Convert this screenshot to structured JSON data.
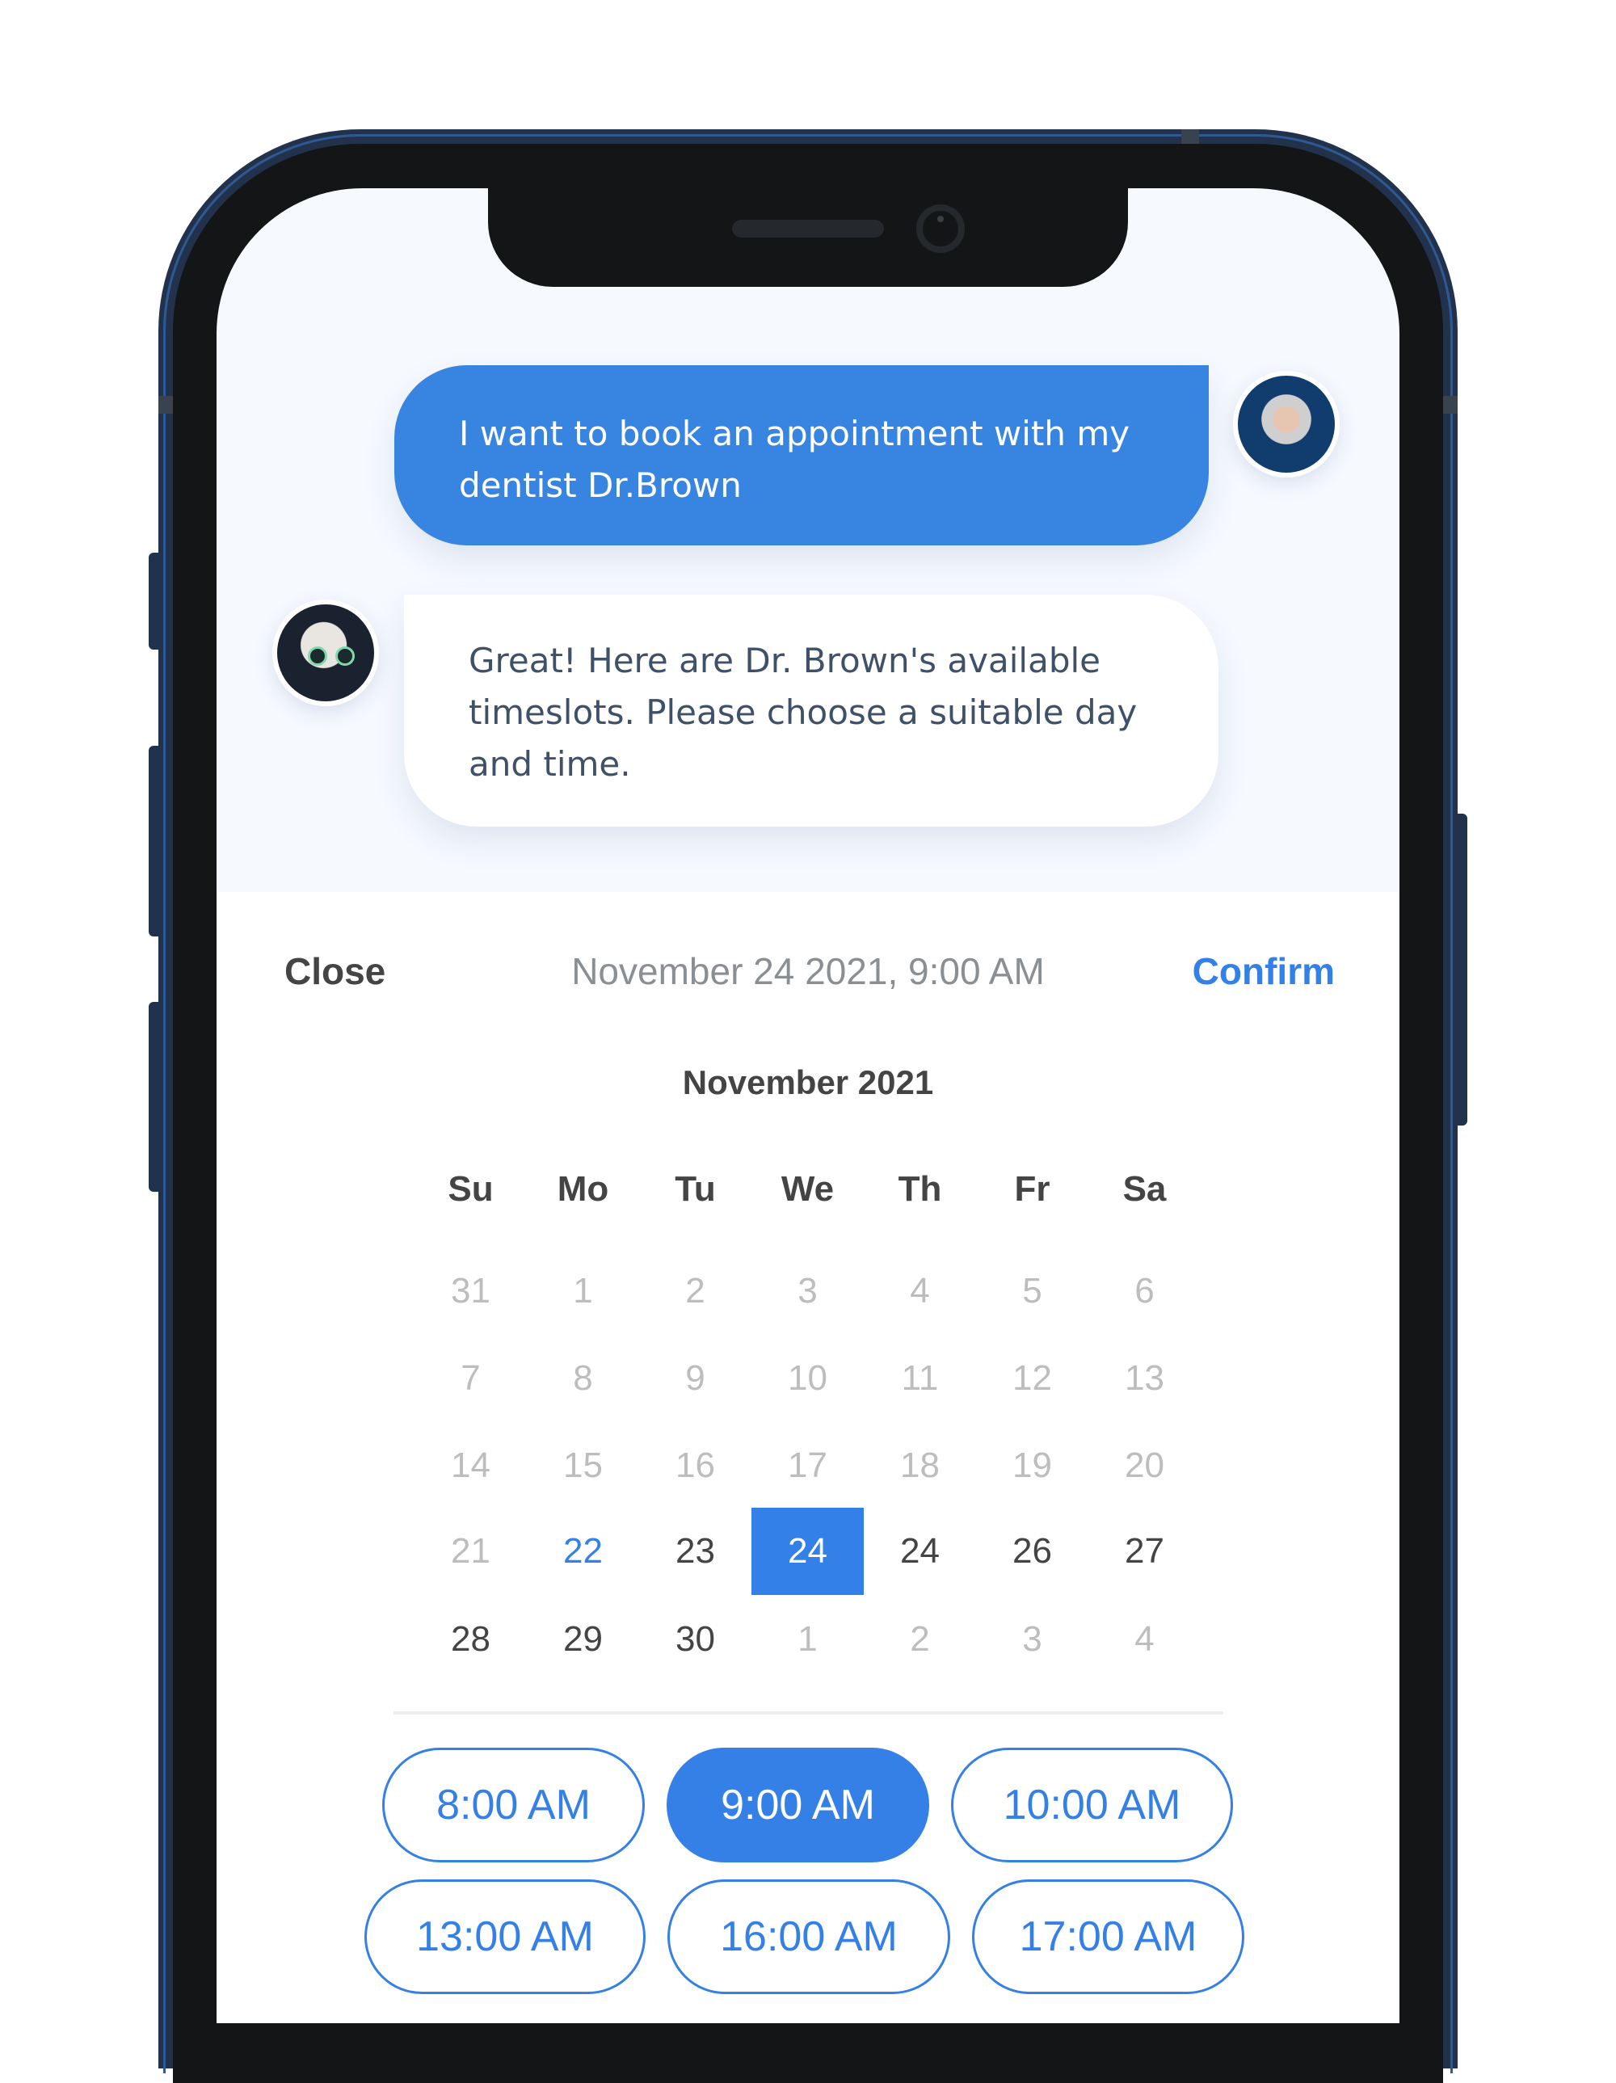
{
  "chat": {
    "user_message": "I want to book an appointment with my dentist Dr.Brown",
    "bot_message": "Great! Here are Dr. Brown's available timeslots. Please choose a suitable day and time."
  },
  "picker": {
    "close_label": "Close",
    "selected_datetime": "November 24 2021, 9:00 AM",
    "confirm_label": "Confirm",
    "month_title": "November 2021",
    "weekdays": [
      "Su",
      "Mo",
      "Tu",
      "We",
      "Th",
      "Fr",
      "Sa"
    ],
    "weeks": [
      [
        {
          "d": "31",
          "s": "other"
        },
        {
          "d": "1",
          "s": "other"
        },
        {
          "d": "2",
          "s": "other"
        },
        {
          "d": "3",
          "s": "other"
        },
        {
          "d": "4",
          "s": "other"
        },
        {
          "d": "5",
          "s": "other"
        },
        {
          "d": "6",
          "s": "other"
        }
      ],
      [
        {
          "d": "7",
          "s": "other"
        },
        {
          "d": "8",
          "s": "other"
        },
        {
          "d": "9",
          "s": "other"
        },
        {
          "d": "10",
          "s": "other"
        },
        {
          "d": "11",
          "s": "other"
        },
        {
          "d": "12",
          "s": "other"
        },
        {
          "d": "13",
          "s": "other"
        }
      ],
      [
        {
          "d": "14",
          "s": "other"
        },
        {
          "d": "15",
          "s": "other"
        },
        {
          "d": "16",
          "s": "other"
        },
        {
          "d": "17",
          "s": "other"
        },
        {
          "d": "18",
          "s": "other"
        },
        {
          "d": "19",
          "s": "other"
        },
        {
          "d": "20",
          "s": "other"
        }
      ],
      [
        {
          "d": "21",
          "s": "other"
        },
        {
          "d": "22",
          "s": "today"
        },
        {
          "d": "23",
          "s": "cur"
        },
        {
          "d": "24",
          "s": "selected"
        },
        {
          "d": "24",
          "s": "cur"
        },
        {
          "d": "26",
          "s": "cur"
        },
        {
          "d": "27",
          "s": "cur"
        }
      ],
      [
        {
          "d": "28",
          "s": "cur"
        },
        {
          "d": "29",
          "s": "cur"
        },
        {
          "d": "30",
          "s": "cur"
        },
        {
          "d": "1",
          "s": "other"
        },
        {
          "d": "2",
          "s": "other"
        },
        {
          "d": "3",
          "s": "other"
        },
        {
          "d": "4",
          "s": "other"
        }
      ]
    ],
    "timeslots": [
      {
        "label": "8:00 AM",
        "selected": false
      },
      {
        "label": "9:00 AM",
        "selected": true
      },
      {
        "label": "10:00 AM",
        "selected": false
      },
      {
        "label": "13:00 AM",
        "selected": false
      },
      {
        "label": "16:00 AM",
        "selected": false
      },
      {
        "label": "17:00 AM",
        "selected": false
      }
    ]
  },
  "colors": {
    "accent": "#3380e8",
    "user_bubble": "#3785e0",
    "bot_text": "#3f5168",
    "phone_frame": "#22324d"
  }
}
